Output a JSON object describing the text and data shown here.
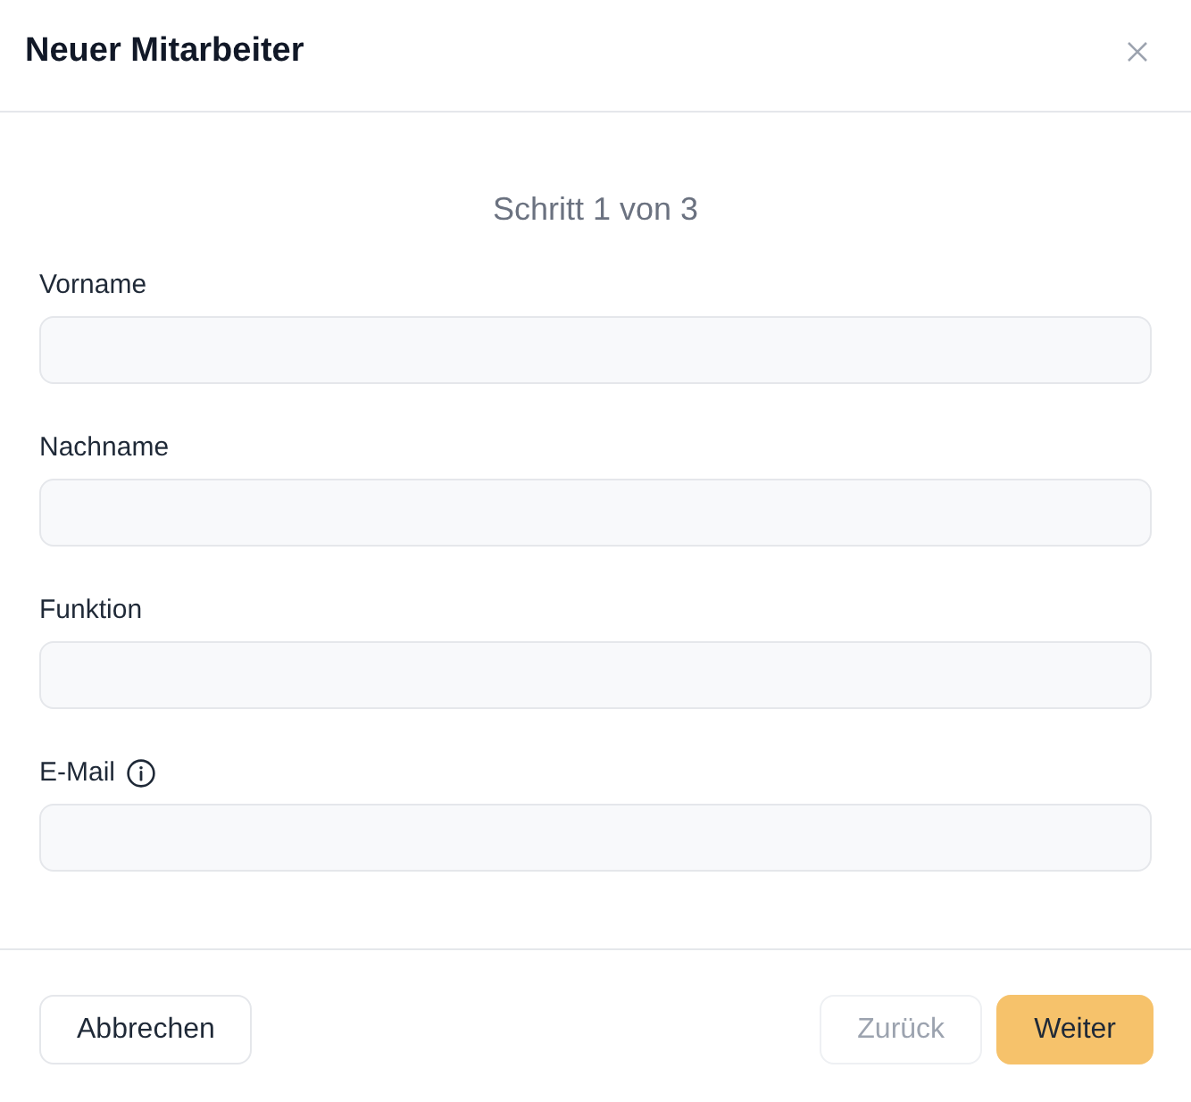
{
  "dialog": {
    "title": "Neuer Mitarbeiter"
  },
  "step_indicator": "Schritt 1 von 3",
  "fields": [
    {
      "label": "Vorname",
      "info": false
    },
    {
      "label": "Nachname",
      "info": false
    },
    {
      "label": "Funktion",
      "info": false
    },
    {
      "label": "E-Mail",
      "info": true
    }
  ],
  "footer": {
    "left_buttons": [
      {
        "label": "Abbrechen",
        "kind": "outline",
        "disabled": false
      }
    ],
    "right_buttons": [
      {
        "label": "Zurück",
        "kind": "outline",
        "disabled": true
      },
      {
        "label": "Weiter",
        "kind": "primary",
        "disabled": false
      }
    ]
  }
}
